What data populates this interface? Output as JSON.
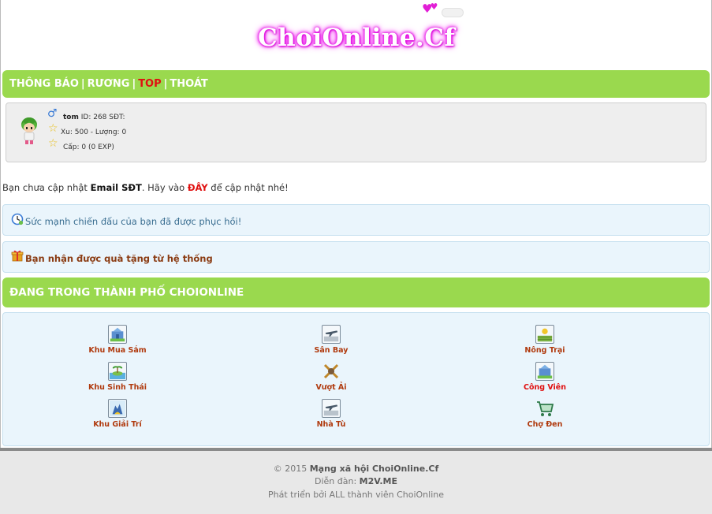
{
  "site": {
    "logo": "ChoiOnline.Cf"
  },
  "nav": {
    "items": [
      "THÔNG BÁO",
      "RƯƠNG",
      "TOP",
      "THOÁT"
    ],
    "separator": "|"
  },
  "profile": {
    "username": "tom",
    "id_text": "ID: 268 SĐT:",
    "currency_text": "Xu: 500 - Lượng: 0",
    "level_text": "Cấp: 0 (0 EXP)"
  },
  "notice": {
    "prefix": "Bạn chưa cập nhật ",
    "fields": "Email SĐT",
    "middle": ". Hãy vào ",
    "link": "ĐÂY",
    "suffix": " để cập nhật nhé!"
  },
  "messages": {
    "power_restored": "Sức mạnh chiến đấu của bạn đã được phục hồi!",
    "gift_received": "Bạn nhận được quà tặng từ hệ thống"
  },
  "city": {
    "heading": "ĐANG TRONG THÀNH PHỐ CHOIONLINE",
    "places": [
      {
        "label": "Khu Mua Sắm",
        "icon": "shopping-building-icon"
      },
      {
        "label": "Sân Bay",
        "icon": "airplane-icon"
      },
      {
        "label": "Nông Trại",
        "icon": "farm-icon"
      },
      {
        "label": "Khu Sinh Thái",
        "icon": "ecology-island-icon"
      },
      {
        "label": "Vượt Ải",
        "icon": "crossed-swords-icon"
      },
      {
        "label": "Công Viên",
        "icon": "park-building-icon"
      },
      {
        "label": "Khu Giải Trí",
        "icon": "entertainment-icon"
      },
      {
        "label": "Nhà Tù",
        "icon": "prison-icon"
      },
      {
        "label": "Chợ Đen",
        "icon": "shopping-cart-icon"
      }
    ]
  },
  "footer": {
    "copyright_prefix": "© 2015 ",
    "copyright_name": "Mạng xã hội ChoiOnline.Cf",
    "forum_prefix": "Diễn đàn: ",
    "forum_name": "M2V.ME",
    "developed_by": "Phát triển bởi ALL thành viên ChoiOnline"
  },
  "colors": {
    "green_bar": "#9ad94e",
    "info_bg": "#eaf5fc",
    "accent_red": "#e01010",
    "place_label": "#b03a0e"
  }
}
